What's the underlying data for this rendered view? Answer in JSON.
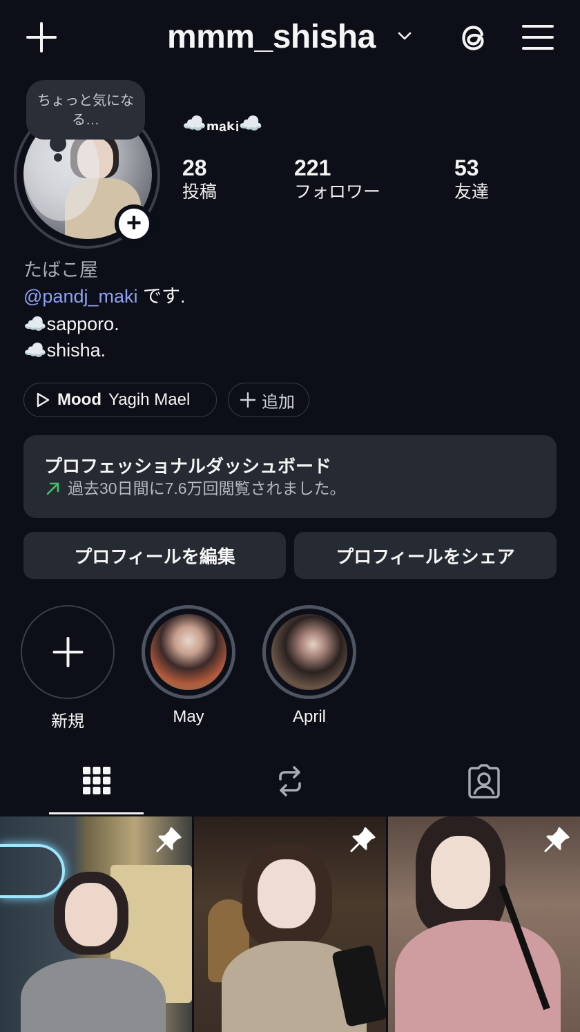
{
  "header": {
    "username": "mmm_shisha"
  },
  "profile": {
    "note": "ちょっと気になる…",
    "display_name": "☁️ₘₐₖᵢ☁️",
    "stats": [
      {
        "value": "28",
        "label": "投稿"
      },
      {
        "value": "221",
        "label": "フォロワー"
      },
      {
        "value": "53",
        "label": "友達"
      }
    ],
    "bio": {
      "category": "たばこ屋",
      "mention": "@pandj_maki",
      "mention_suffix": " です.",
      "line3": "☁️sapporo.",
      "line4": "☁️shisha."
    }
  },
  "chips": {
    "music_title": "Mood",
    "music_artist": "Yagih Mael",
    "add_label": "追加"
  },
  "dashboard": {
    "title": "プロフェッショナルダッシュボード",
    "subtitle": "過去30日間に7.6万回閲覧されました。"
  },
  "buttons": {
    "edit": "プロフィールを編集",
    "share": "プロフィールをシェア"
  },
  "highlights": [
    {
      "label": "新規"
    },
    {
      "label": "May"
    },
    {
      "label": "April"
    }
  ],
  "tabs": {
    "active": "posts"
  },
  "colors": {
    "background": "#0c0f17",
    "card": "#262a33",
    "mention": "#8fa2f0",
    "trend_arrow": "#3ec46d"
  }
}
